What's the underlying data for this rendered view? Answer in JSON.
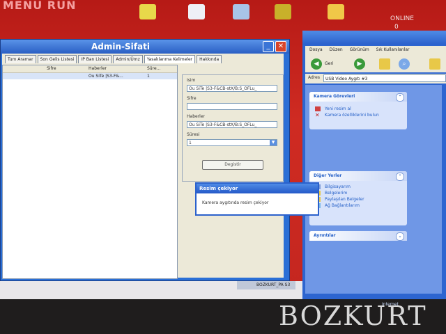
{
  "site": {
    "logo": "MENU RUN",
    "logo_sub": "",
    "top_labels": [
      "",
      "",
      "",
      "",
      ""
    ],
    "online_label": "ONLINE",
    "online_count": "0"
  },
  "bezel": {
    "text": "BOZKURT"
  },
  "admin_window": {
    "title": "Admin-Sifati",
    "close": "✕",
    "minimize": "_",
    "tabs": [
      "Tum Aramar",
      "Son Gelis Listesi",
      "IP Ban Listesi",
      "Admin/Ümz",
      "Yasaklanma Kelimeler",
      "Hakkında"
    ],
    "active_tab": 4,
    "list": {
      "columns": [
        "",
        "Sifre",
        "Haberler",
        "Süre..."
      ],
      "rows": [
        [
          "",
          "",
          "Ou SiTe |S3-F&...",
          "1"
        ]
      ]
    },
    "form": {
      "field1_label": "Isim",
      "field1_value": "Ou SiTe |S3-F&CB-stX/B:S_OFLu_",
      "field2_label": "Sifre",
      "field2_value": "",
      "field3_label": "Haberler",
      "field3_value": "Ou SiTe |S3-F&CB-stX/B:S_OFLu_",
      "field4_label": "Süresi",
      "field4_value": "1",
      "button_label": "Degistir"
    }
  },
  "explorer": {
    "menu": [
      "Dosya",
      "Düzen",
      "Görünüm",
      "Sık Kullanılanlar"
    ],
    "back_label": "Geri",
    "address_label": "Adres",
    "address_value": "USB Video Aygıtı #3",
    "camera_panel": {
      "title": "Kamera Görevleri",
      "items": [
        "Yeni resim al",
        "Kamera özelliklerini bulun"
      ]
    },
    "places_panel": {
      "title": "Diğer Yerler",
      "items": [
        "Bilgisayarım",
        "Belgelerim",
        "Paylaşılan Belgeler",
        "Ağ Bağlantılarım"
      ]
    },
    "details_panel": {
      "title": "Ayrıntılar"
    },
    "status": "Internet"
  },
  "dialog": {
    "title": "Resim çekiyor",
    "message": "Kamera aygıtında resim çekiyor"
  },
  "taskbar_item": "BOZKURT_PA S3"
}
